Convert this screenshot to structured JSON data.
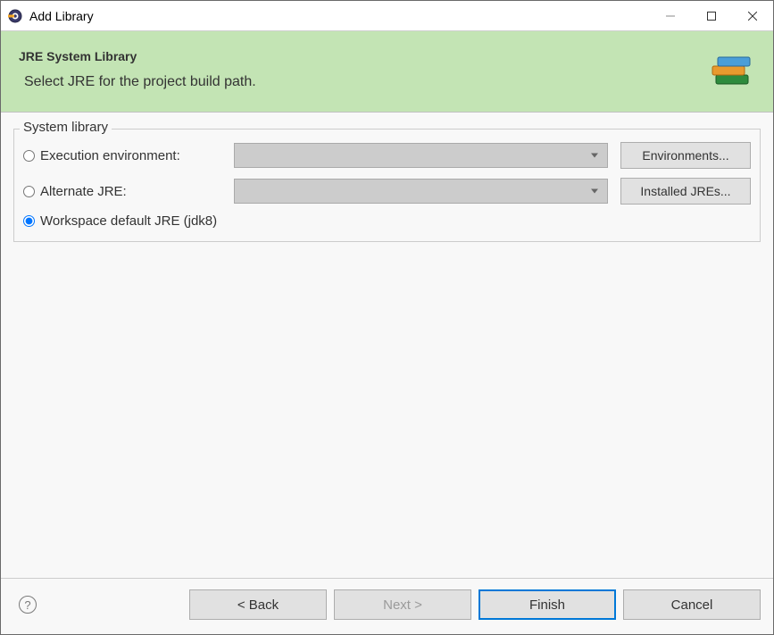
{
  "window": {
    "title": "Add Library"
  },
  "banner": {
    "title": "JRE System Library",
    "subtitle": "Select JRE for the project build path."
  },
  "fieldset": {
    "legend": "System library",
    "options": {
      "execution_env": {
        "label": "Execution environment:",
        "button": "Environments..."
      },
      "alternate": {
        "label": "Alternate JRE:",
        "button": "Installed JREs..."
      },
      "workspace_default": {
        "label": "Workspace default JRE (jdk8)"
      }
    }
  },
  "footer": {
    "back": "< Back",
    "next": "Next >",
    "finish": "Finish",
    "cancel": "Cancel"
  }
}
